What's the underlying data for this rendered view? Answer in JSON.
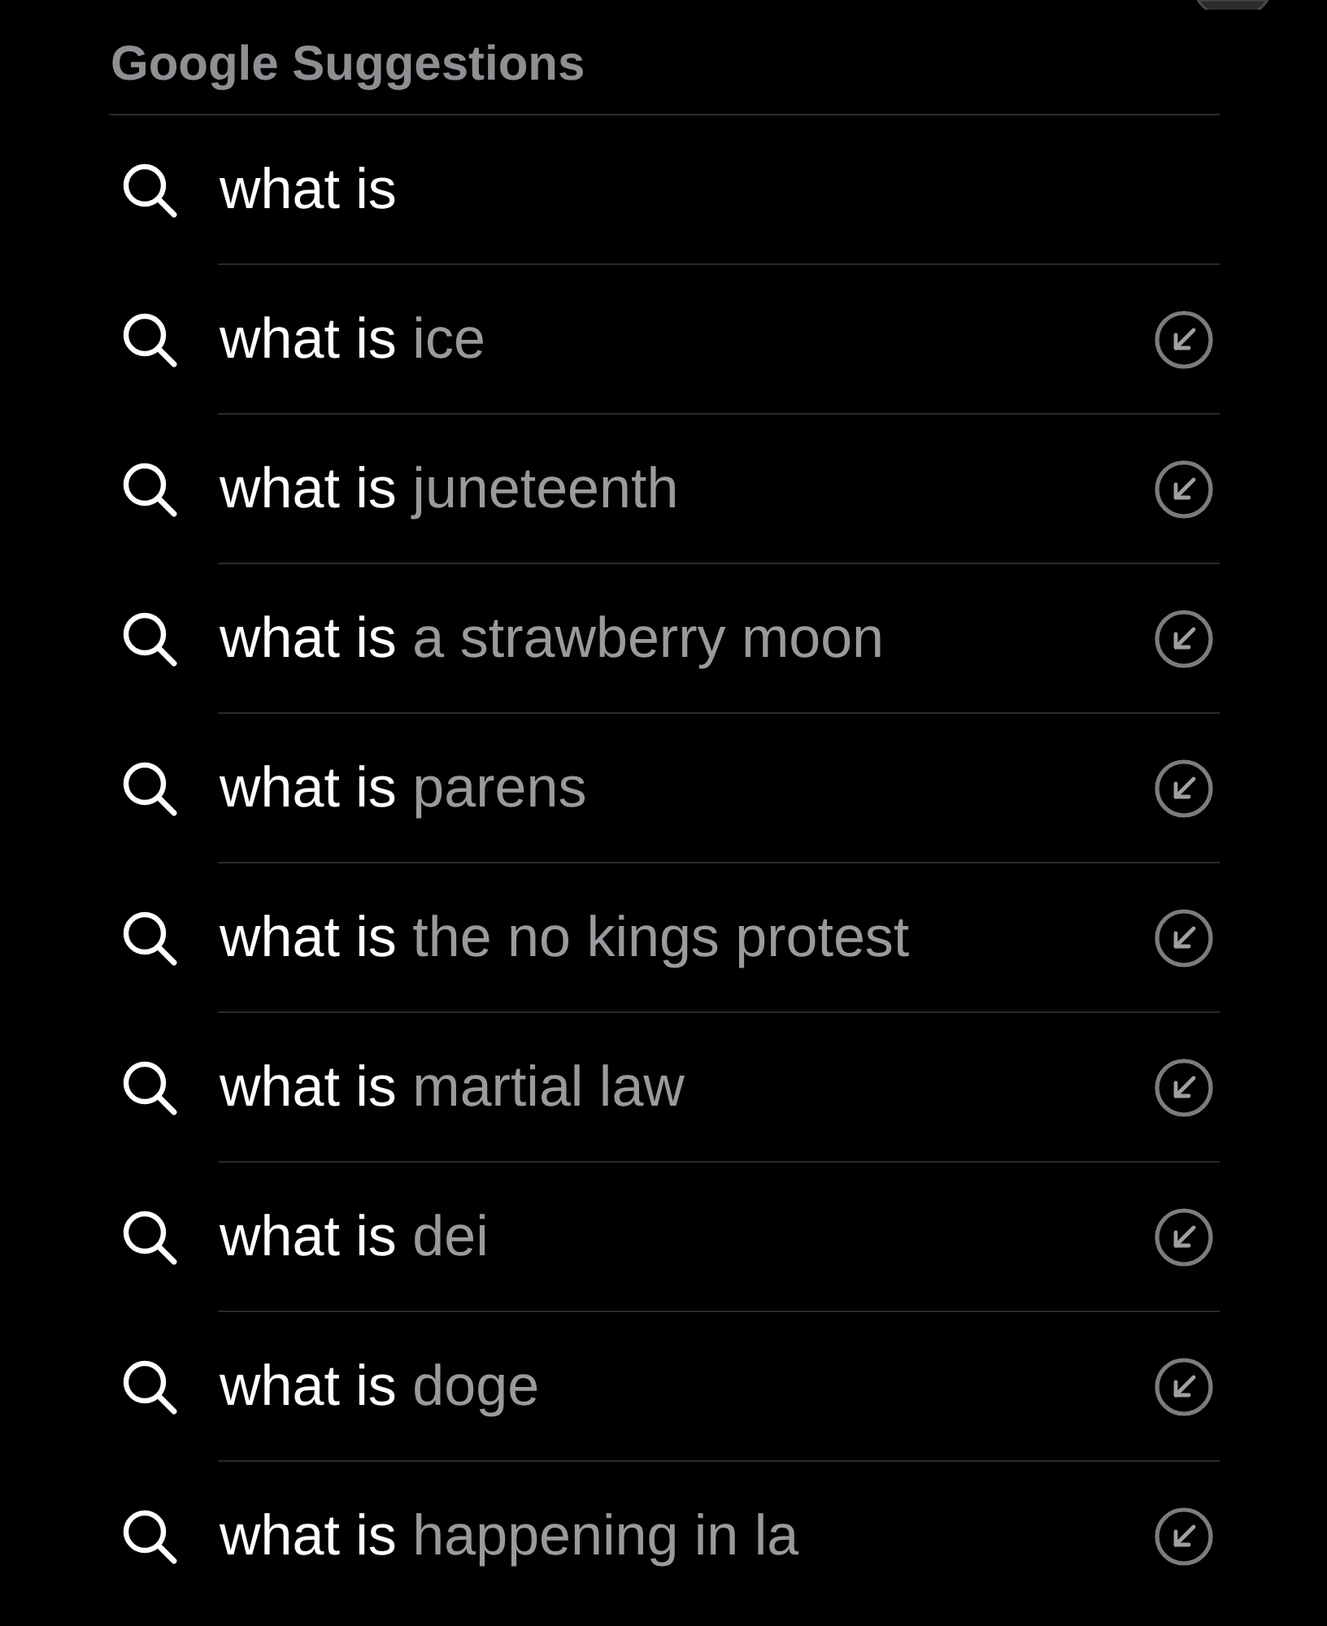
{
  "section": {
    "title": "Google Suggestions"
  },
  "suggestions": [
    {
      "kind": "query",
      "prefix": "what is"
    },
    {
      "kind": "suggestion",
      "prefix": "what is",
      "completion": "ice"
    },
    {
      "kind": "suggestion",
      "prefix": "what is",
      "completion": "juneteenth"
    },
    {
      "kind": "suggestion",
      "prefix": "what is",
      "completion": "a strawberry moon"
    },
    {
      "kind": "suggestion",
      "prefix": "what is",
      "completion": "parens"
    },
    {
      "kind": "suggestion",
      "prefix": "what is",
      "completion": "the no kings protest"
    },
    {
      "kind": "suggestion",
      "prefix": "what is",
      "completion": "martial law"
    },
    {
      "kind": "suggestion",
      "prefix": "what is",
      "completion": "dei"
    },
    {
      "kind": "suggestion",
      "prefix": "what is",
      "completion": "doge"
    },
    {
      "kind": "suggestion",
      "prefix": "what is",
      "completion": "happening in la"
    }
  ]
}
